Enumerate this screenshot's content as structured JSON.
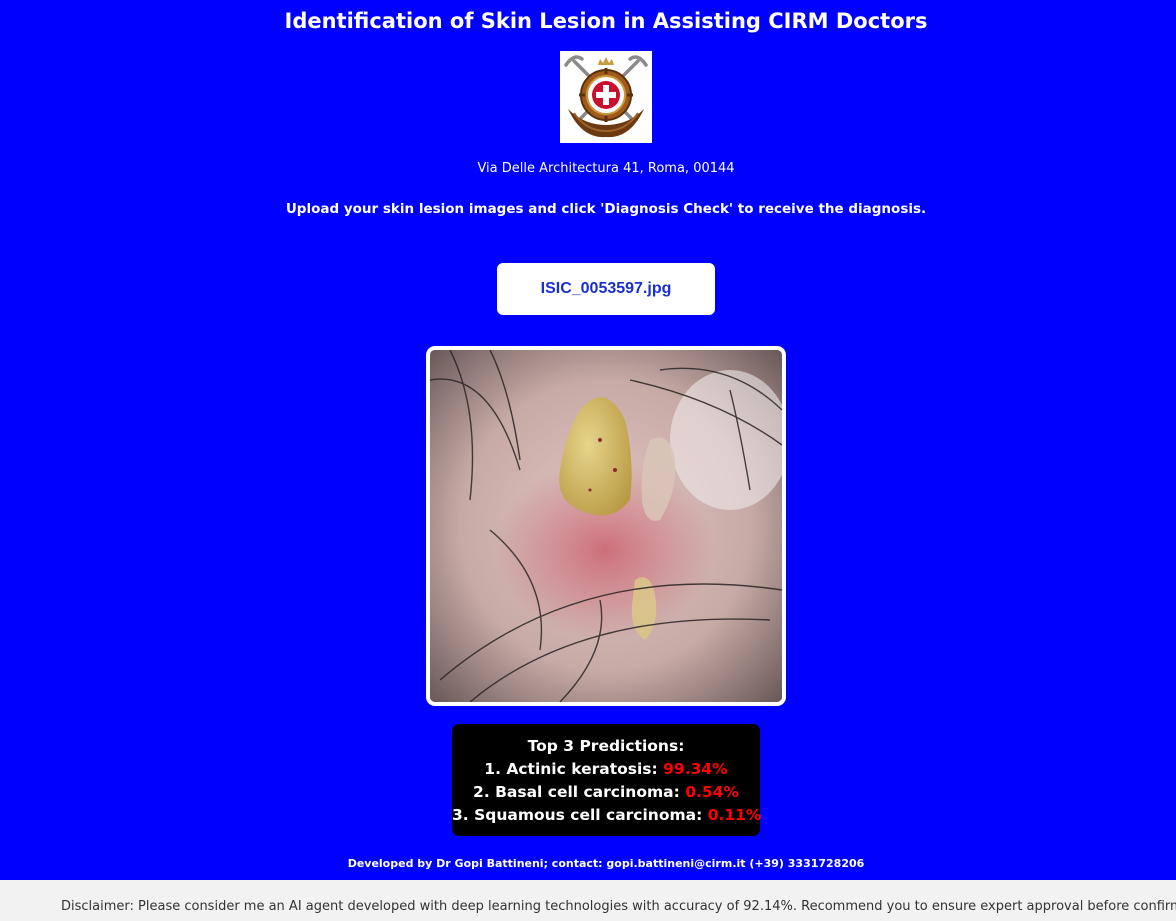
{
  "header": {
    "title": "Identification of Skin Lesion in Assisting CIRM Doctors",
    "address": "Via Delle Architectura 41, Roma, 00144",
    "instructions": "Upload your skin lesion images and click 'Diagnosis Check' to receive the diagnosis."
  },
  "logo": {
    "icon": "cirm-emblem-icon"
  },
  "upload": {
    "filename": "ISIC_0053597.jpg"
  },
  "lesion_image": {
    "icon": "dermoscopy-lesion-photo"
  },
  "predictions": {
    "title": "Top 3 Predictions:",
    "items": [
      {
        "label": "1. Actinic keratosis: ",
        "value": "99.34%"
      },
      {
        "label": "2. Basal cell carcinoma: ",
        "value": "0.54%"
      },
      {
        "label": "3. Squamous cell carcinoma: ",
        "value": "0.11%"
      }
    ]
  },
  "footer": {
    "developer": "Developed by Dr Gopi Battineni; contact: gopi.battineni@cirm.it (+39) 3331728206",
    "disclaimer": "Disclaimer: Please consider me an AI agent developed with deep learning technologies with accuracy of 92.14%. Recommend you to ensure expert approval before confirmation."
  },
  "colors": {
    "background": "#0000ff",
    "percent": "#ff0000",
    "button_text": "#1a2fd0",
    "predictions_bg": "#000000",
    "disclaimer_bg": "#f2f2f2"
  }
}
